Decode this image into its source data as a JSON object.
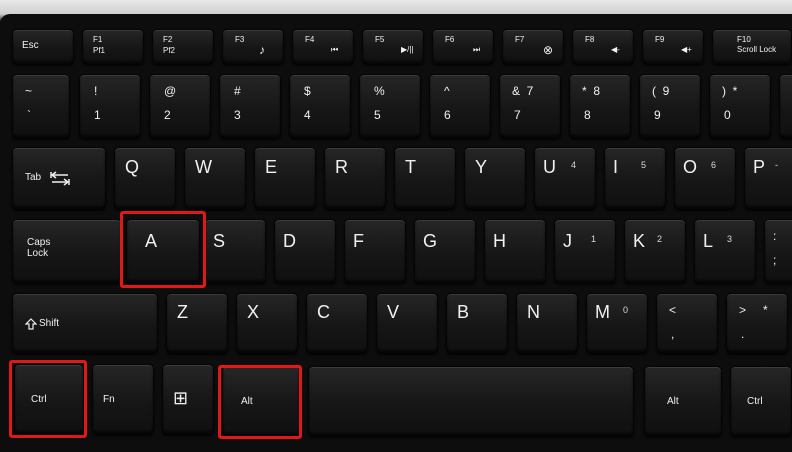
{
  "keys": {
    "esc": "Esc",
    "f1": "F1",
    "f1_sub": "Pf1",
    "f2": "F2",
    "f2_sub": "Pf2",
    "f3": "F3",
    "f3_glyph": "♪",
    "f4": "F4",
    "f4_glyph": "⏮",
    "f5": "F5",
    "f5_glyph": "▶/||",
    "f6": "F6",
    "f6_glyph": "⏭",
    "f7": "F7",
    "f7_glyph": "⊗",
    "f8": "F8",
    "f8_glyph": "◀-",
    "f9": "F9",
    "f9_glyph": "◀+",
    "f10": "F10",
    "f10_sub": "Scroll Lock",
    "grave_top": "~",
    "grave_bot": "`",
    "n1_top": "!",
    "n1": "1",
    "n2_top": "@",
    "n2": "2",
    "n3_top": "#",
    "n3": "3",
    "n4_top": "$",
    "n4": "4",
    "n5_top": "%",
    "n5": "5",
    "n6_top": "^",
    "n6": "6",
    "n7_top": "&  7",
    "n7": "7",
    "n8_top": "*  8",
    "n8": "8",
    "n9_top": "(  9",
    "n9": "9",
    "n0_top": ")  *",
    "n0": "0",
    "tab": "Tab",
    "q": "Q",
    "w": "W",
    "e": "E",
    "r": "R",
    "t": "T",
    "y": "Y",
    "u": "U",
    "u_sub": "4",
    "i": "I",
    "i_sub": "5",
    "o": "O",
    "o_sub": "6",
    "p": "P",
    "p_sub": "-",
    "caps": "Caps\nLock",
    "a": "A",
    "s": "S",
    "d": "D",
    "f": "F",
    "g": "G",
    "h": "H",
    "j": "J",
    "j_sub": "1",
    "k": "K",
    "k_sub": "2",
    "l": "L",
    "l_sub": "3",
    "semi_top": ":",
    "semi_bot": ";",
    "shift": "Shift",
    "z": "Z",
    "x": "X",
    "c": "C",
    "v": "V",
    "b": "B",
    "n": "N",
    "m": "M",
    "m_sub": "0",
    "comma_top": "<",
    "comma_bot": ",",
    "period_top": ">",
    "period_sub": "*",
    "period_bot": ".",
    "ctrl_left": "Ctrl",
    "fn": "Fn",
    "win_glyph": "⊞",
    "alt_left": "Alt",
    "space": "",
    "alt_right": "Alt",
    "ctrl_right": "Ctrl"
  },
  "highlight_color": "#e01818"
}
